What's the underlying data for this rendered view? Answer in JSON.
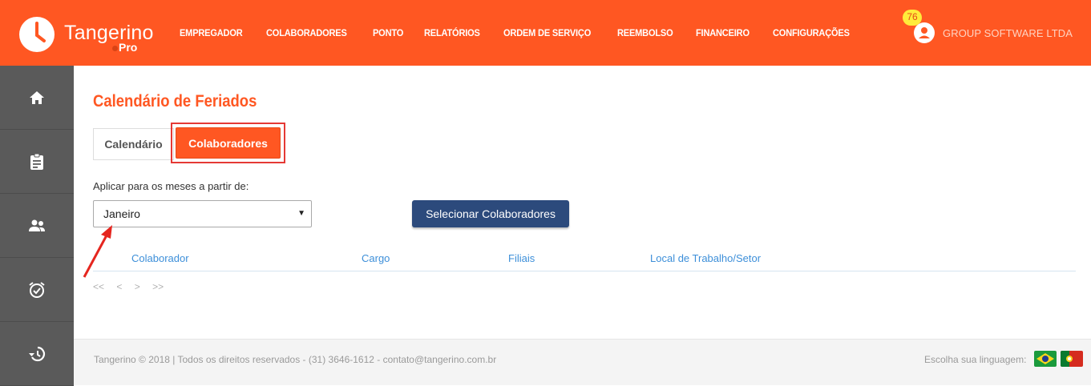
{
  "app": {
    "name": "Tangerino",
    "sub": "Pro"
  },
  "nav": [
    {
      "label": "EMPREGADOR"
    },
    {
      "label": "COLABORADORES"
    },
    {
      "label": "PONTO"
    },
    {
      "label": "RELATÓRIOS"
    },
    {
      "label": "ORDEM DE SERVIÇO"
    },
    {
      "label": "REEMBOLSO"
    },
    {
      "label": "FINANCEIRO"
    },
    {
      "label": "CONFIGURAÇÕES"
    }
  ],
  "user": {
    "badge": "76",
    "company": "GROUP SOFTWARE LTDA"
  },
  "sidebar": {
    "items": [
      {
        "icon": "home-icon"
      },
      {
        "icon": "clipboard-icon"
      },
      {
        "icon": "people-icon"
      },
      {
        "icon": "alarm-clock-icon"
      },
      {
        "icon": "history-icon"
      }
    ]
  },
  "page": {
    "title": "Calendário de Feriados",
    "tabs": {
      "calendario": "Calendário",
      "colaboradores": "Colaboradores"
    },
    "apply_label": "Aplicar para os meses a partir de:",
    "month_select": "Janeiro",
    "select_button": "Selecionar Colaboradores",
    "table": {
      "columns": [
        "Colaborador",
        "Cargo",
        "Filiais",
        "Local de Trabalho/Setor"
      ]
    },
    "pager": {
      "first": "<<",
      "prev": "<",
      "next": ">",
      "last": ">>"
    }
  },
  "footer": {
    "text": "Tangerino © 2018 | Todos os direitos reservados - (31) 3646-1612 - contato@tangerino.com.br",
    "lang_label": "Escolha sua linguagem:"
  },
  "colors": {
    "brand": "#ff5722",
    "sidebar": "#5a5a5a",
    "primary_button": "#2c4a7c",
    "highlight": "#e53935",
    "link": "#3d8fd9"
  }
}
